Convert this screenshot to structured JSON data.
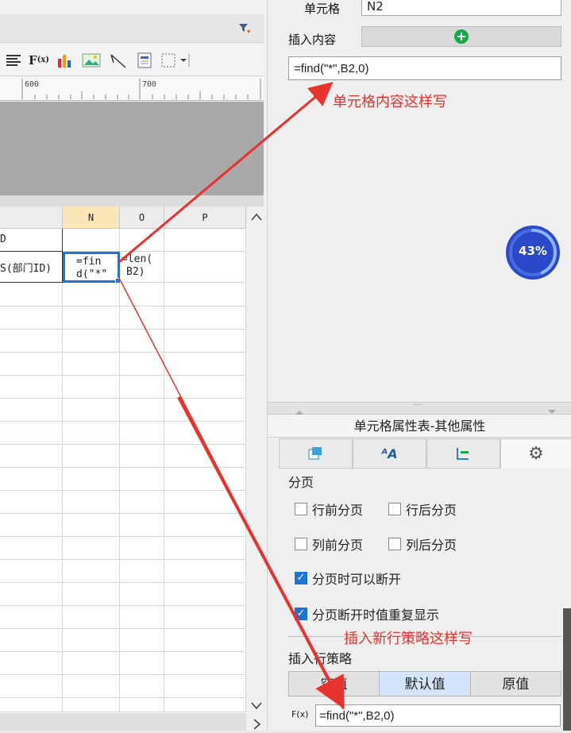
{
  "editor": {
    "ruler_labels": [
      "600",
      "700"
    ],
    "columns": [
      "N",
      "O",
      "P"
    ],
    "row1": {
      "a": "D"
    },
    "row2": {
      "a": "S(部门ID)",
      "n_line1": "=fin",
      "n_line2": "d(\"*\"",
      "o_line1": "=len(",
      "o_line2": "B2)"
    }
  },
  "cell_panel": {
    "cell_label": "单元格",
    "cell_value": "N2",
    "insert_label": "插入内容",
    "formula": "=find(\"*\",B2,0)"
  },
  "progress": {
    "text": "43%",
    "value": 0.43
  },
  "props": {
    "title": "单元格属性表-其他属性",
    "section_pagination": "分页",
    "opt_before_row": "行前分页",
    "opt_after_row": "行后分页",
    "opt_before_col": "列前分页",
    "opt_after_col": "列后分页",
    "opt_can_break": "分页时可以断开",
    "opt_repeat": "分页断开时值重复显示",
    "checked": {
      "before_row": false,
      "after_row": false,
      "before_col": false,
      "after_col": false,
      "can_break": true,
      "repeat": true
    },
    "section_insert": "插入行策略",
    "strategy_tabs": [
      "空值",
      "默认值",
      "原值"
    ],
    "strategy_selected": "默认值",
    "fx_label": "F(x)",
    "strategy_formula": "=find(\"*\",B2,0)"
  },
  "annotations": {
    "a1": "单元格内容这样写",
    "a2": "插入新行策略这样写"
  },
  "colors": {
    "annotation": "#e8322e",
    "selection": "#1e73d9",
    "accent_green": "#19a74a",
    "progress": "#2a49c9"
  }
}
